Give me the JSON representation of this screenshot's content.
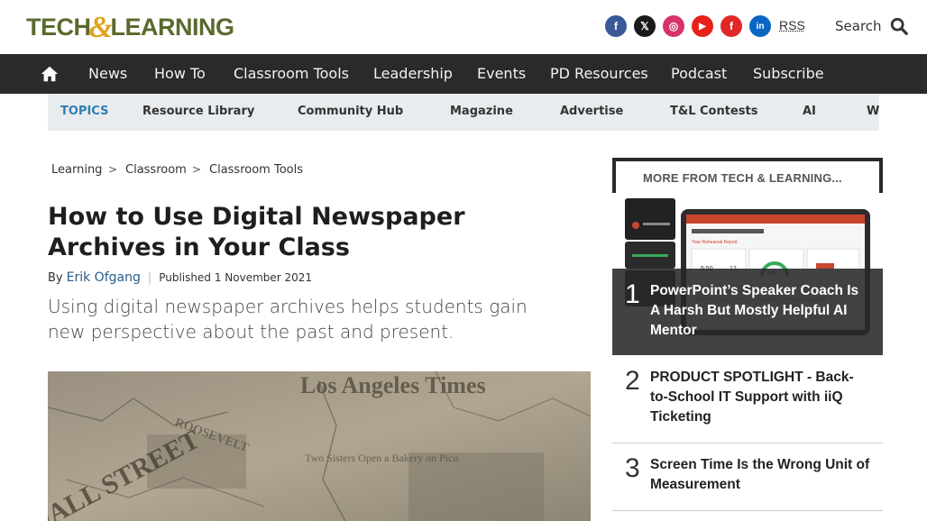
{
  "header": {
    "logo_left": "TECH",
    "logo_amp": "&",
    "logo_right": "LEARNING",
    "social": [
      {
        "icon": "facebook-icon",
        "glyph": "f",
        "color": "#3b5998"
      },
      {
        "icon": "x-icon",
        "glyph": "𝕏",
        "color": "#1a1a1a"
      },
      {
        "icon": "instagram-icon",
        "glyph": "◎",
        "color": "#d6336c"
      },
      {
        "icon": "youtube-icon",
        "glyph": "▶",
        "color": "#e62117"
      },
      {
        "icon": "flipboard-icon",
        "glyph": "f",
        "color": "#e12828"
      },
      {
        "icon": "linkedin-icon",
        "glyph": "in",
        "color": "#0a66c2"
      }
    ],
    "rss": "RSS",
    "search_label": "Search"
  },
  "nav": {
    "items": [
      "News",
      "How To",
      "Classroom Tools",
      "Leadership",
      "Events",
      "PD Resources",
      "Podcast",
      "Subscribe"
    ]
  },
  "topics": {
    "label": "TOPICS",
    "items": [
      "Resource Library",
      "Community Hub",
      "Magazine",
      "Advertise",
      "T&L Contests",
      "AI",
      "W"
    ]
  },
  "breadcrumb": {
    "items": [
      "Learning",
      "Classroom",
      "Classroom Tools"
    ],
    "separator": ">"
  },
  "article": {
    "title": "How to Use Digital Newspaper Archives in Your Class",
    "by": "By",
    "author": "Erik Ofgang",
    "divider": "|",
    "published": "Published 1 November 2021",
    "strap": "Using digital newspaper archives helps students gain new perspective about the past and present.",
    "hero_words": [
      "Los Angeles Times",
      "WALL STREET",
      "Two Sisters Open a Bakery on Pico",
      "ROOSEVELT"
    ]
  },
  "sidebar": {
    "heading": "MORE FROM TECH & LEARNING...",
    "items": [
      {
        "num": "1",
        "text": "PowerPoint’s Speaker Coach Is A Harsh But Mostly Helpful AI Mentor"
      },
      {
        "num": "2",
        "text": "PRODUCT SPOTLIGHT - Back-to-School IT Support with iiQ Ticketing"
      },
      {
        "num": "3",
        "text": "Screen Time Is the Wrong Unit of Measurement"
      }
    ],
    "screen": {
      "report_title": "Your Rehearsal Report",
      "metric_a": "5:50",
      "metric_b": "12",
      "metric_c": "355"
    }
  }
}
